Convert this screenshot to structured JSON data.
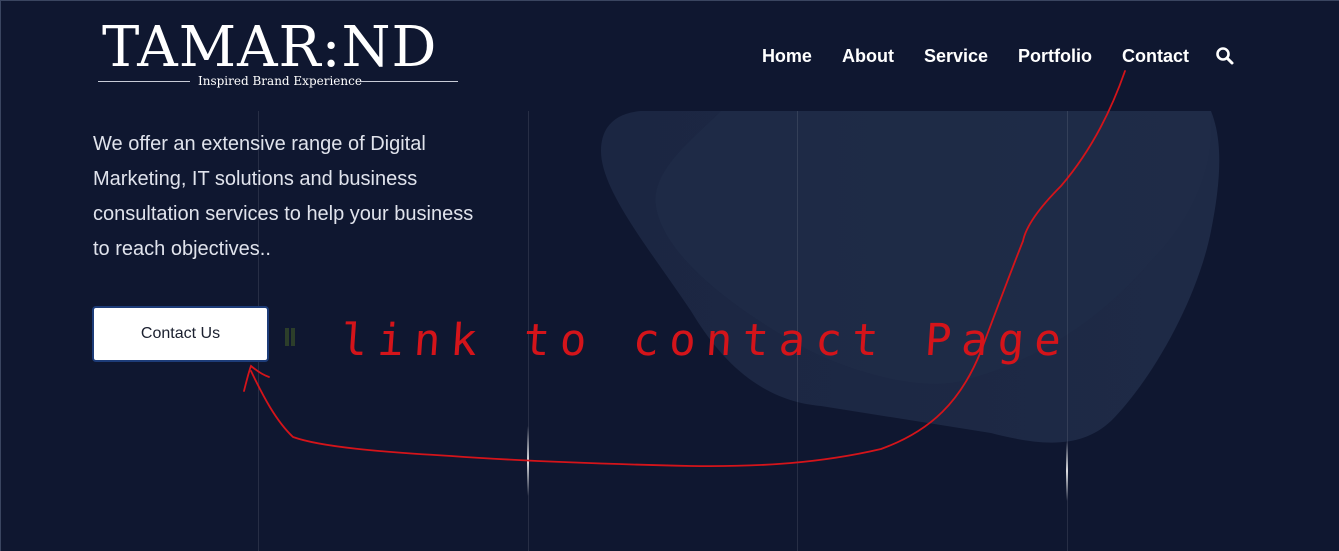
{
  "logo": {
    "wordmark": "TAMAR:ND",
    "tagline": "Inspired Brand Experience"
  },
  "nav": {
    "items": [
      {
        "label": "Home"
      },
      {
        "label": "About"
      },
      {
        "label": "Service"
      },
      {
        "label": "Portfolio"
      },
      {
        "label": "Contact"
      }
    ],
    "search_icon": "search-icon"
  },
  "hero": {
    "description": "We offer an extensive range of Digital Marketing, IT solutions and business consultation services to help your business to reach objectives..",
    "cta_label": "Contact Us"
  },
  "annotation": {
    "text": "link to contact Page",
    "color": "#d4141a"
  },
  "colors": {
    "background": "#0f1730",
    "shape": "#1c2740",
    "button_border": "#1d3c78"
  }
}
